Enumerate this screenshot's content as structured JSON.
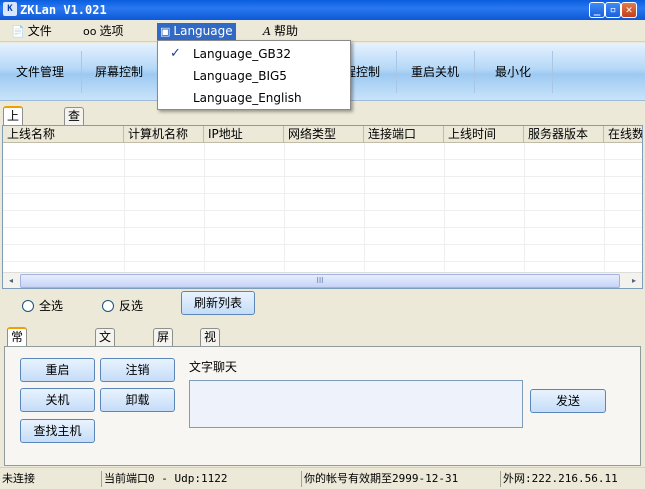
{
  "window": {
    "title": "ZKLan V1.021",
    "icon": "app-logo-icon"
  },
  "window_controls": {
    "minimize": "_",
    "maximize": "▫",
    "close": "✕"
  },
  "menubar": [
    {
      "label": "文件",
      "icon": "file-menu-icon"
    },
    {
      "label": "选项",
      "icon": "glasses-icon"
    },
    {
      "label": "Language",
      "icon": "language-icon"
    },
    {
      "label": "帮助",
      "icon": "help-icon"
    }
  ],
  "language_menu": {
    "items": [
      {
        "label": "Language_GB32",
        "checked": true
      },
      {
        "label": "Language_BIG5",
        "checked": false
      },
      {
        "label": "Language_English",
        "checked": false
      }
    ],
    "check_mark": "✓"
  },
  "toolbar": [
    "文件管理",
    "屏幕控制",
    "进程控制",
    "重启关机",
    "最小化"
  ],
  "tabs_top": [
    "上线主机",
    "查看公告"
  ],
  "host_table": {
    "columns": [
      "上线名称",
      "计算机名称",
      "IP地址",
      "网络类型",
      "连接端口",
      "上线时间",
      "服务器版本",
      "在线数"
    ],
    "rows": []
  },
  "scroll": {
    "left": "◂",
    "right": "▸",
    "thumb": "III"
  },
  "select": {
    "all": "全选",
    "invert": "反选",
    "refresh": "刷新列表"
  },
  "tabs_bottom": [
    "常用广播命令",
    "文件分发",
    "屏幕墙",
    "视频墙"
  ],
  "broadcast": {
    "restart": "重启",
    "logout": "注销",
    "shutdown": "关机",
    "uninstall": "卸载",
    "find_host": "查找主机",
    "chat_label": "文字聊天",
    "chat_value": "",
    "send": "发送"
  },
  "status": {
    "connection": "未连接",
    "port": "当前端口0 - Udp:1122",
    "expiry": "你的帐号有效期至2999-12-31",
    "wan": "外网:222.216.56.11"
  }
}
